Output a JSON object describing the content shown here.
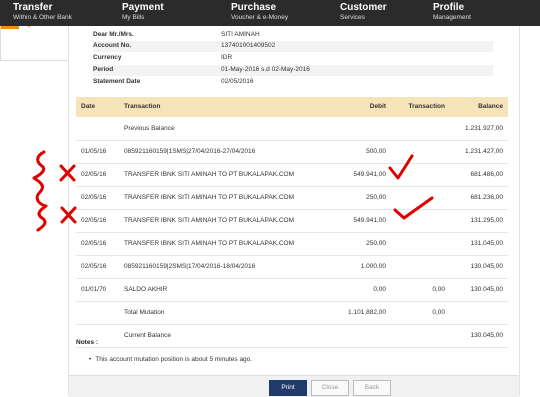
{
  "nav": [
    {
      "title": "Transfer",
      "sub": "Within & Other Bank"
    },
    {
      "title": "Payment",
      "sub": "My Bills"
    },
    {
      "title": "Purchase",
      "sub": "Voucher & e-Money"
    },
    {
      "title": "Customer",
      "sub": "Services"
    },
    {
      "title": "Profile",
      "sub": "Management"
    }
  ],
  "info": [
    {
      "label": "Dear Mr./Mrs.",
      "value": "SITI AMINAH"
    },
    {
      "label": "Account No.",
      "value": "137401001409502"
    },
    {
      "label": "Currency",
      "value": "IDR"
    },
    {
      "label": "Period",
      "value": "01-May-2016 s.d 02-May-2016"
    },
    {
      "label": "Statement Date",
      "value": "02/05/2016"
    }
  ],
  "table": {
    "headers": {
      "date": "Date",
      "transaction": "Transaction",
      "debit": "Debit",
      "transaction2": "Transaction",
      "balance": "Balance"
    },
    "rows": [
      {
        "date": "",
        "transaction": "Previous Balance",
        "debit": "",
        "credit": "",
        "balance": "1.231.927,00"
      },
      {
        "date": "01/05/16",
        "transaction": "085921160159|1SMS|27/04/2016-27/04/2016",
        "debit": "500,00",
        "credit": "",
        "balance": "1.231.427,00"
      },
      {
        "date": "02/05/16",
        "transaction": "TRANSFER IBNK SITI AMINAH TO PT BUKALAPAK.COM",
        "debit": "549.941,00",
        "credit": "",
        "balance": "681.486,00"
      },
      {
        "date": "02/05/16",
        "transaction": "TRANSFER IBNK SITI AMINAH TO PT BUKALAPAK.COM",
        "debit": "250,00",
        "credit": "",
        "balance": "681.236,00"
      },
      {
        "date": "02/05/16",
        "transaction": "TRANSFER IBNK SITI AMINAH TO PT BUKALAPAK.COM",
        "debit": "549.941,00",
        "credit": "",
        "balance": "131.295,00"
      },
      {
        "date": "02/05/16",
        "transaction": "TRANSFER IBNK SITI AMINAH TO PT BUKALAPAK.COM",
        "debit": "250,00",
        "credit": "",
        "balance": "131.045,00"
      },
      {
        "date": "02/05/16",
        "transaction": "085921160159|2SMS|17/04/2016-18/04/2016",
        "debit": "1.000,00",
        "credit": "",
        "balance": "130.045,00"
      },
      {
        "date": "01/01/70",
        "transaction": "SALDO AKHIR",
        "debit": "0,00",
        "credit": "0,00",
        "balance": "130.045,00"
      },
      {
        "date": "",
        "transaction": "Total Mutation",
        "debit": "1.101.882,00",
        "credit": "0,00",
        "balance": ""
      },
      {
        "date": "",
        "transaction": "Current Balance",
        "debit": "",
        "credit": "",
        "balance": "130.045,00"
      }
    ]
  },
  "notes": {
    "label": "Notes :",
    "items": [
      "This account mutation position is about 5 minutes ago."
    ]
  },
  "buttons": {
    "print": "Print",
    "close": "Close",
    "back": "Back"
  },
  "colors": {
    "nav_bg": "#2b2b2b",
    "accent": "#f29100",
    "header_bg": "#f6e3b7",
    "primary_button": "#1f3a6b",
    "annotation_red": "#e00000"
  }
}
